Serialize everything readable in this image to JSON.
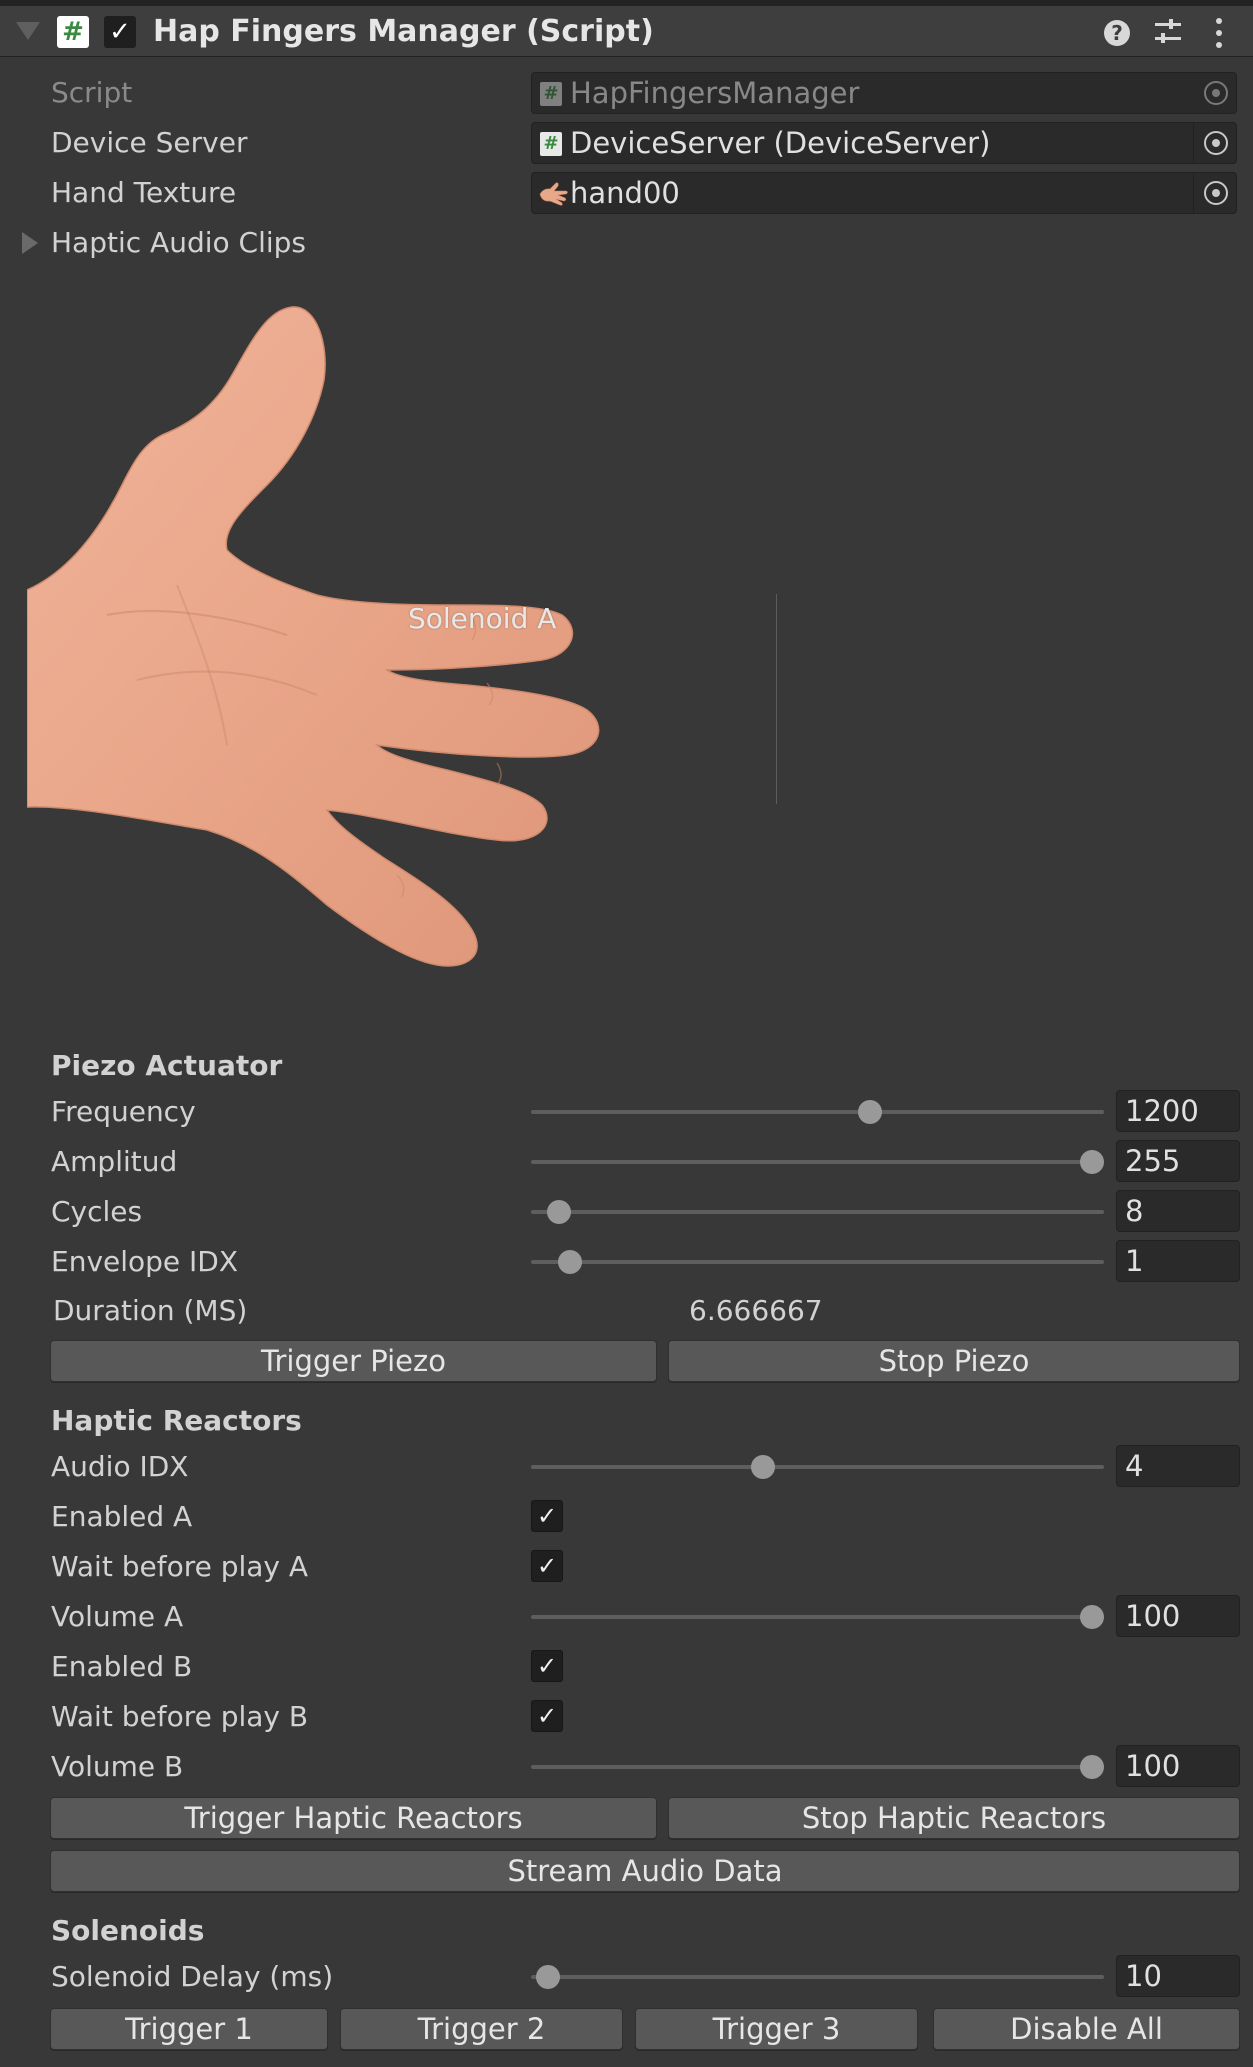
{
  "component": {
    "title": "Hap Fingers Manager (Script)",
    "script_icon": "#",
    "enabled_mark": "✓",
    "help_icon": "?",
    "colors": {
      "background": "#383838",
      "header": "#3e3e3e",
      "field": "#2a2a2a",
      "button": "#585858"
    }
  },
  "fields": {
    "script": {
      "label": "Script",
      "value": "HapFingersManager"
    },
    "device_server": {
      "label": "Device Server",
      "value": "DeviceServer (DeviceServer)"
    },
    "hand_texture": {
      "label": "Hand Texture",
      "value": "hand00"
    },
    "haptic_audio_clips": {
      "label": "Haptic Audio Clips"
    }
  },
  "hand_preview": {
    "solenoid_label": "Solenoid A"
  },
  "piezo": {
    "title": "Piezo Actuator",
    "frequency": {
      "label": "Frequency",
      "value": "1200",
      "fraction": 0.595
    },
    "amplitud": {
      "label": "Amplitud",
      "value": "255",
      "fraction": 1.0
    },
    "cycles": {
      "label": "Cycles",
      "value": "8",
      "fraction": 0.03
    },
    "envelope": {
      "label": "Envelope IDX",
      "value": "1",
      "fraction": 0.05
    },
    "duration": {
      "label": "Duration (MS)",
      "value": "6.666667"
    },
    "trigger_label": "Trigger Piezo",
    "stop_label": "Stop Piezo"
  },
  "reactors": {
    "title": "Haptic Reactors",
    "audio_idx": {
      "label": "Audio IDX",
      "value": "4",
      "fraction": 0.4
    },
    "enabled_a": {
      "label": "Enabled A",
      "checked": true
    },
    "wait_a": {
      "label": "Wait before play A",
      "checked": true
    },
    "volume_a": {
      "label": "Volume A",
      "value": "100",
      "fraction": 1.0
    },
    "enabled_b": {
      "label": "Enabled B",
      "checked": true
    },
    "wait_b": {
      "label": "Wait before play B",
      "checked": true
    },
    "volume_b": {
      "label": "Volume B",
      "value": "100",
      "fraction": 1.0
    },
    "check_mark": "✓",
    "trigger_label": "Trigger Haptic Reactors",
    "stop_label": "Stop Haptic Reactors",
    "stream_label": "Stream Audio Data"
  },
  "solenoids": {
    "title": "Solenoids",
    "delay": {
      "label": "Solenoid Delay (ms)",
      "value": "10",
      "fraction": 0.01
    },
    "trigger1": "Trigger 1",
    "trigger2": "Trigger 2",
    "trigger3": "Trigger 3",
    "disable_all": "Disable All"
  }
}
